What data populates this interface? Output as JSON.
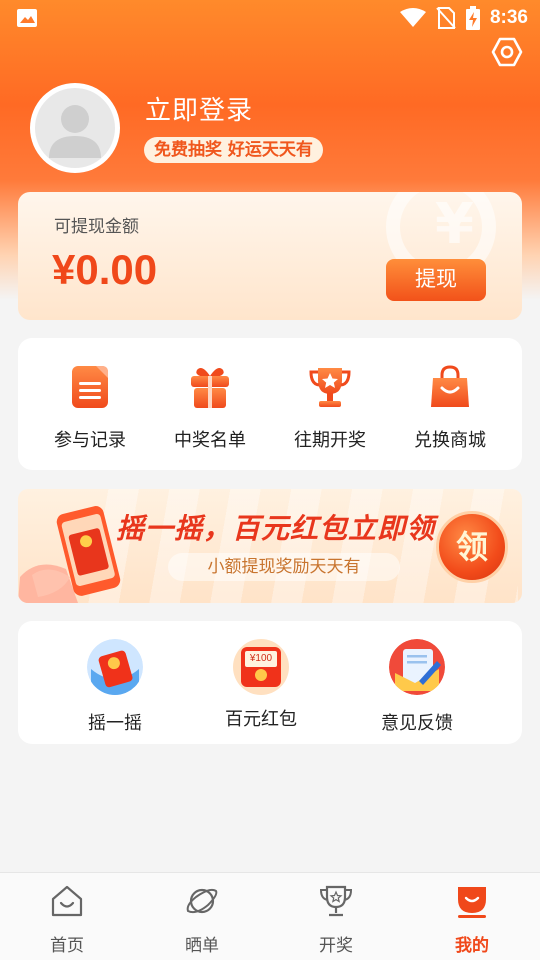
{
  "status_bar": {
    "time": "8:36"
  },
  "profile": {
    "login_title": "立即登录",
    "badge": "免费抽奖 好运天天有"
  },
  "wallet": {
    "label": "可提现金额",
    "amount": "¥0.00",
    "withdraw_label": "提现"
  },
  "menu": {
    "items": [
      {
        "label": "参与记录",
        "icon": "clipboard-icon"
      },
      {
        "label": "中奖名单",
        "icon": "gift-icon"
      },
      {
        "label": "往期开奖",
        "icon": "trophy-icon"
      },
      {
        "label": "兑换商城",
        "icon": "shopping-bag-icon"
      }
    ]
  },
  "banner": {
    "title": "摇一摇，百元红包立即领",
    "subtitle": "小额提现奖励天天有",
    "claim_label": "领"
  },
  "tools": {
    "items": [
      {
        "label": "摇一摇",
        "icon": "shake-red-packet-icon"
      },
      {
        "label": "百元红包",
        "icon": "red-packet-100-icon",
        "icon_text": "¥100"
      },
      {
        "label": "意见反馈",
        "icon": "feedback-icon"
      }
    ]
  },
  "tab_bar": {
    "tabs": [
      {
        "label": "首页",
        "icon": "home-icon",
        "active": false
      },
      {
        "label": "晒单",
        "icon": "planet-icon",
        "active": false
      },
      {
        "label": "开奖",
        "icon": "trophy-icon",
        "active": false
      },
      {
        "label": "我的",
        "icon": "profile-icon",
        "active": true
      }
    ]
  },
  "colors": {
    "accent": "#f0481a",
    "header_start": "#ff8a2b",
    "header_mid": "#ff6a24"
  }
}
